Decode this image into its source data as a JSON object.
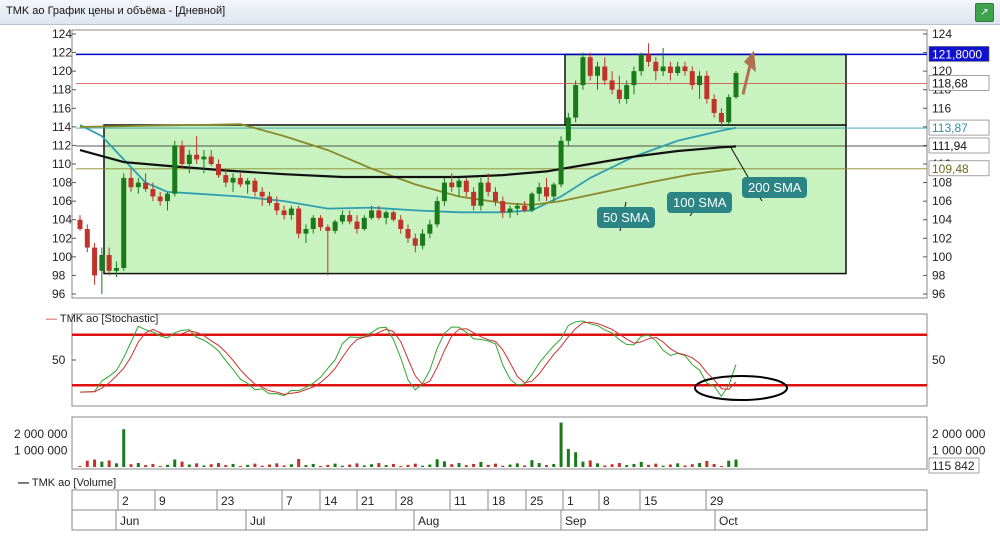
{
  "window": {
    "title": "TMK ao График цены и объёма - [Дневной]",
    "pin_icon": "pin-icon"
  },
  "panels": {
    "stochastic_title": "TMK ao [Stochastic]",
    "volume_title": "TMK ao [Volume]"
  },
  "callouts": {
    "sma50": "50 SMA",
    "sma100": "100 SMA",
    "sma200": "200 SMA"
  },
  "colors": {
    "bull": "#1a7a1a",
    "bear": "#c0332b",
    "box_fill": "#c8f2c0",
    "sma50": "#2f9fb0",
    "sma100": "#8a8a2a",
    "sma200": "#111111",
    "resistance": "#0000cc",
    "stoch_band": "#e01010",
    "arrow": "#b07050"
  },
  "chart_data": [
    {
      "type": "candlestick",
      "title": "",
      "ylim": [
        96,
        124
      ],
      "yticks": [
        96,
        98,
        100,
        102,
        104,
        106,
        108,
        110,
        112,
        114,
        116,
        118,
        120,
        122,
        124
      ],
      "x_day_labels": [
        "2",
        "9",
        "23",
        "7",
        "14",
        "21",
        "28",
        "11",
        "18",
        "25",
        "1",
        "8",
        "15",
        "29"
      ],
      "x_month_labels": [
        "Jun",
        "Jul",
        "Aug",
        "Sep",
        "Oct"
      ],
      "candles": [
        [
          104.0,
          104.5,
          102.8,
          103.0
        ],
        [
          103.0,
          103.5,
          100.5,
          101.0
        ],
        [
          101.0,
          101.5,
          97.0,
          98.0
        ],
        [
          98.5,
          101.0,
          96.0,
          100.2
        ],
        [
          100.2,
          101.0,
          98.0,
          98.5
        ],
        [
          98.5,
          99.5,
          97.8,
          98.8
        ],
        [
          98.8,
          109.0,
          98.5,
          108.5
        ],
        [
          108.5,
          109.5,
          107.0,
          107.5
        ],
        [
          107.5,
          108.5,
          106.8,
          108.0
        ],
        [
          108.0,
          109.0,
          107.0,
          107.3
        ],
        [
          107.3,
          108.0,
          106.0,
          106.5
        ],
        [
          106.5,
          107.0,
          105.5,
          106.0
        ],
        [
          106.0,
          107.0,
          105.0,
          106.8
        ],
        [
          106.8,
          112.5,
          106.5,
          112.0
        ],
        [
          112.0,
          112.5,
          109.5,
          110.0
        ],
        [
          110.0,
          111.5,
          109.0,
          111.0
        ],
        [
          111.0,
          113.0,
          110.0,
          110.5
        ],
        [
          110.5,
          111.5,
          109.0,
          110.8
        ],
        [
          110.8,
          111.5,
          109.8,
          110.0
        ],
        [
          110.0,
          110.5,
          108.5,
          108.8
        ],
        [
          108.8,
          109.5,
          107.5,
          108.0
        ],
        [
          108.0,
          109.0,
          107.0,
          108.5
        ],
        [
          108.5,
          109.0,
          107.5,
          107.8
        ],
        [
          107.8,
          108.5,
          106.8,
          108.2
        ],
        [
          108.2,
          108.5,
          106.5,
          107.0
        ],
        [
          107.0,
          107.5,
          105.5,
          106.5
        ],
        [
          106.5,
          107.0,
          105.5,
          105.8
        ],
        [
          105.8,
          106.5,
          104.5,
          105.0
        ],
        [
          105.0,
          105.5,
          104.0,
          104.5
        ],
        [
          104.5,
          105.5,
          104.0,
          105.2
        ],
        [
          105.2,
          105.5,
          102.0,
          102.5
        ],
        [
          102.5,
          103.5,
          101.5,
          103.0
        ],
        [
          103.0,
          104.5,
          102.5,
          104.2
        ],
        [
          104.2,
          104.5,
          102.8,
          103.2
        ],
        [
          103.2,
          103.5,
          98.0,
          102.8
        ],
        [
          102.8,
          104.0,
          102.5,
          103.8
        ],
        [
          103.8,
          105.0,
          103.5,
          104.5
        ],
        [
          104.5,
          105.0,
          103.5,
          103.8
        ],
        [
          103.8,
          104.5,
          102.5,
          103.0
        ],
        [
          103.0,
          104.5,
          102.8,
          104.2
        ],
        [
          104.2,
          105.5,
          104.0,
          105.0
        ],
        [
          105.0,
          105.5,
          104.0,
          104.2
        ],
        [
          104.2,
          105.0,
          103.5,
          104.8
        ],
        [
          104.8,
          105.0,
          103.8,
          104.0
        ],
        [
          104.0,
          104.5,
          102.5,
          103.0
        ],
        [
          103.0,
          103.5,
          101.5,
          102.0
        ],
        [
          102.0,
          102.5,
          100.5,
          101.2
        ],
        [
          101.2,
          103.0,
          100.8,
          102.5
        ],
        [
          102.5,
          104.0,
          102.0,
          103.5
        ],
        [
          103.5,
          106.5,
          103.2,
          106.0
        ],
        [
          106.0,
          108.5,
          105.5,
          108.0
        ],
        [
          108.0,
          109.0,
          107.0,
          107.5
        ],
        [
          107.5,
          108.5,
          106.5,
          108.2
        ],
        [
          108.2,
          108.5,
          106.5,
          107.0
        ],
        [
          107.0,
          107.5,
          105.0,
          105.5
        ],
        [
          105.5,
          108.5,
          105.0,
          108.0
        ],
        [
          108.0,
          109.0,
          106.5,
          107.0
        ],
        [
          107.0,
          107.5,
          105.5,
          106.0
        ],
        [
          106.0,
          106.5,
          104.2,
          104.8
        ],
        [
          104.8,
          105.5,
          104.2,
          105.2
        ],
        [
          105.2,
          105.8,
          104.5,
          105.5
        ],
        [
          105.5,
          106.0,
          104.8,
          105.0
        ],
        [
          105.0,
          107.0,
          104.8,
          106.8
        ],
        [
          106.8,
          108.0,
          106.0,
          107.5
        ],
        [
          107.5,
          108.5,
          106.0,
          106.5
        ],
        [
          106.5,
          108.0,
          106.0,
          107.8
        ],
        [
          107.8,
          113.0,
          107.5,
          112.5
        ],
        [
          112.5,
          115.5,
          112.0,
          115.0
        ],
        [
          115.0,
          119.0,
          114.5,
          118.5
        ],
        [
          118.5,
          122.0,
          118.0,
          121.5
        ],
        [
          121.5,
          122.0,
          119.0,
          119.5
        ],
        [
          119.5,
          121.0,
          118.0,
          120.5
        ],
        [
          120.5,
          121.5,
          118.5,
          119.0
        ],
        [
          119.0,
          120.0,
          117.5,
          118.0
        ],
        [
          118.0,
          119.5,
          116.5,
          117.0
        ],
        [
          117.0,
          119.0,
          116.5,
          118.5
        ],
        [
          118.5,
          120.5,
          117.5,
          120.0
        ],
        [
          120.0,
          122.0,
          119.5,
          121.8
        ],
        [
          121.8,
          123.0,
          120.5,
          121.0
        ],
        [
          121.0,
          121.5,
          119.0,
          120.0
        ],
        [
          120.0,
          122.5,
          119.5,
          120.5
        ],
        [
          120.5,
          121.0,
          119.0,
          119.8
        ],
        [
          119.8,
          121.0,
          119.5,
          120.5
        ],
        [
          120.5,
          121.0,
          119.5,
          120.0
        ],
        [
          120.0,
          120.5,
          118.0,
          118.5
        ],
        [
          118.5,
          120.0,
          117.0,
          119.5
        ],
        [
          119.5,
          120.0,
          116.5,
          117.0
        ],
        [
          117.0,
          117.5,
          115.0,
          115.5
        ],
        [
          115.5,
          116.0,
          114.0,
          114.5
        ],
        [
          114.5,
          117.5,
          114.2,
          117.2
        ],
        [
          117.2,
          120.0,
          117.0,
          119.8
        ]
      ],
      "sma50_label": "113,87",
      "sma100_label": "109,48",
      "sma200_label": "111,94",
      "last_price_label": "118,68",
      "resistance_label": "121,8000",
      "resistance_level": 121.8
    },
    {
      "type": "line",
      "title": "TMK ao [Stochastic]",
      "ylim": [
        0,
        100
      ],
      "yticks": [
        50
      ],
      "upper_band": 80,
      "lower_band": 20
    },
    {
      "type": "bar",
      "title": "TMK ao [Volume]",
      "ylim": [
        0,
        2800000
      ],
      "yticks_labels": [
        "2 000 000",
        "1 000 000"
      ],
      "last_volume_label": "115 842",
      "spikes": [
        {
          "index": 6,
          "value": 2300000
        },
        {
          "index": 66,
          "value": 2700000
        },
        {
          "index": 67,
          "value": 1100000
        },
        {
          "index": 68,
          "value": 900000
        }
      ]
    }
  ]
}
